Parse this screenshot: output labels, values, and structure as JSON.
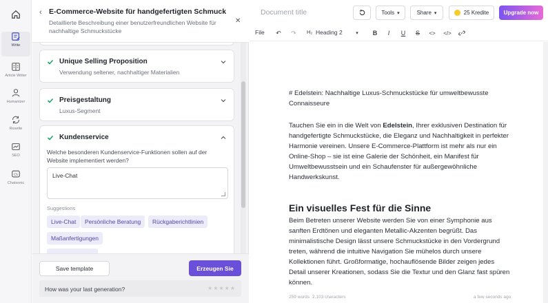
{
  "rail": {
    "items": [
      {
        "label": "Write",
        "icon": "write-icon"
      },
      {
        "label": "Article Writer",
        "icon": "article-writer-icon"
      },
      {
        "label": "Humanizer",
        "icon": "humanizer-icon"
      },
      {
        "label": "Rewrite",
        "icon": "rewrite-icon"
      },
      {
        "label": "SEO",
        "icon": "seo-icon"
      },
      {
        "label": "Chatsonic",
        "icon": "chatsonic-icon"
      }
    ]
  },
  "panel": {
    "title": "E-Commerce-Website für handgefertigten Schmuck",
    "subtitle": "Detaillierte Beschreibung einer benutzerfreundlichen Website für nachhaltige Schmuckstücke",
    "cards": [
      {
        "title": "Unique Selling Proposition",
        "subtitle": "Verwendung seltener, nachhaltiger Materialien"
      },
      {
        "title": "Preisgestaltung",
        "subtitle": "Luxus-Segment"
      }
    ],
    "expanded": {
      "title": "Kundenservice",
      "question": "Welche besonderen Kundenservice-Funktionen sollen auf der Website implementiert werden?",
      "answer": "Live-Chat",
      "suggestions_label": "Suggestions",
      "suggestions": [
        "Live-Chat",
        "Persönliche Beratung",
        "Rückgaberichtlinien",
        "Maßanfertigungen"
      ]
    },
    "save_label": "Save template",
    "generate_label": "Erzeugen Sie",
    "feedback_question": "How was your last generation?"
  },
  "editor": {
    "doc_title_placeholder": "Document title",
    "tools_label": "Tools",
    "share_label": "Share",
    "credits_label": "25 Kredite",
    "upgrade_label": "Upgrade now",
    "toolbar": {
      "file": "File",
      "heading": "Heading 2"
    },
    "content": {
      "p1": "# Edelstein: Nachhaltige Luxus-Schmuckstücke für umweltbewusste Connaisseure",
      "p2_before": "Tauchen Sie ein in die Welt von ",
      "p2_bold": "Edelstein",
      "p2_after": ", Ihrer exklusiven Destination für handgefertigte Schmuckstücke, die Eleganz und Nachhaltigkeit in perfekter Harmonie vereinen. Unsere E-Commerce-Plattform ist mehr als nur ein Online-Shop – sie ist eine Galerie der Schönheit, ein Manifest für Umweltbewusstsein und ein Schaufenster für außergewöhnliche Handwerkskunst.",
      "h2": "Ein visuelles Fest für die Sinne",
      "p3": "Beim Betreten unserer Website werden Sie von einer Symphonie aus sanften Erdtönen und eleganten Metallic-Akzenten begrüßt. Das minimalistische Design lässt unsere Schmuckstücke in den Vordergrund treten, während die intuitive Navigation Sie mühelos durch unsere Kollektionen führt. Großformatige, hochauflösende Bilder zeigen jedes Detail unserer Kreationen, sodass Sie die Textur und den Glanz fast spüren können."
    },
    "status": {
      "words": "259 words",
      "chars": "2.103 characters",
      "saved": "a few seconds ago"
    }
  },
  "colors": {
    "accent": "#6a4fd8",
    "chip_bg": "#ecebfa",
    "chip_text": "#5146a8",
    "check": "#22a06b"
  }
}
